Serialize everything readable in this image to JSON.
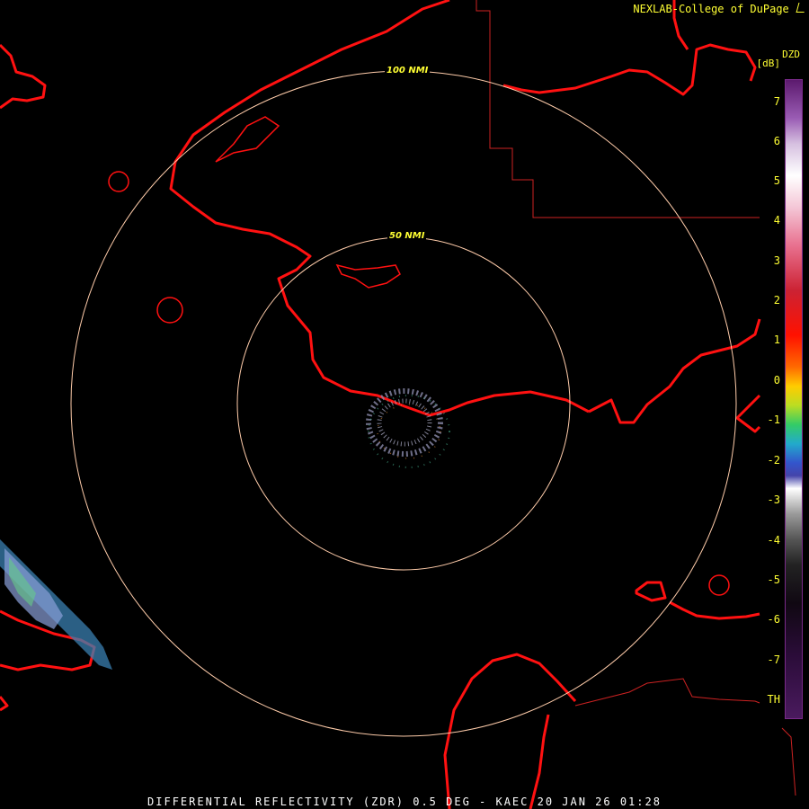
{
  "header": {
    "credit_text": "NEXLAB-College of DuPage"
  },
  "range_rings": [
    {
      "label": "50 NMI"
    },
    {
      "label": "100 NMI"
    }
  ],
  "legend": {
    "product": "DZD",
    "unit": "[dB]",
    "ticks": [
      "7",
      "6",
      "5",
      "4",
      "3",
      "2",
      "1",
      "0",
      "-1",
      "-2",
      "-3",
      "-4",
      "-5",
      "-6",
      "-7",
      "TH"
    ]
  },
  "footer": {
    "caption": "DIFFERENTIAL REFLECTIVITY (ZDR) 0.5 DEG - KAEC 20 JAN 26 01:28"
  },
  "colors": {
    "background": "#000000",
    "coastline": "#ff1111",
    "border_lines": "#cc2222",
    "range_ring": "#ffccaa",
    "label_text": "#ffff33"
  }
}
